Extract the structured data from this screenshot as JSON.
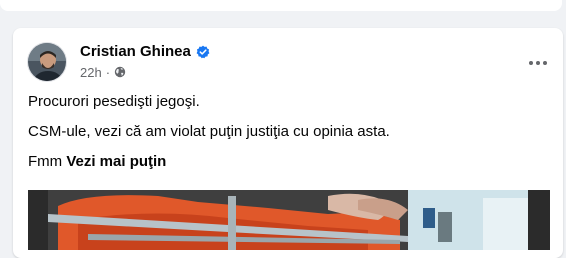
{
  "post": {
    "author_name": "Cristian Ghinea",
    "timestamp": "22h",
    "audience_icon": "globe-icon",
    "verified_icon": "verified-badge-icon",
    "more_icon": "more-horizontal-icon",
    "text_lines": [
      "Procurori pesedişti jegoşi.",
      "CSM-ule, vezi că am violat puţin justiţia cu opinia asta."
    ],
    "text_last_prefix": "Fmm",
    "see_more_label": "Vezi mai puţin"
  },
  "colors": {
    "background": "#f0f2f5",
    "card": "#ffffff",
    "primary_text": "#050505",
    "secondary_text": "#65676b",
    "verified_blue": "#1877f2"
  }
}
